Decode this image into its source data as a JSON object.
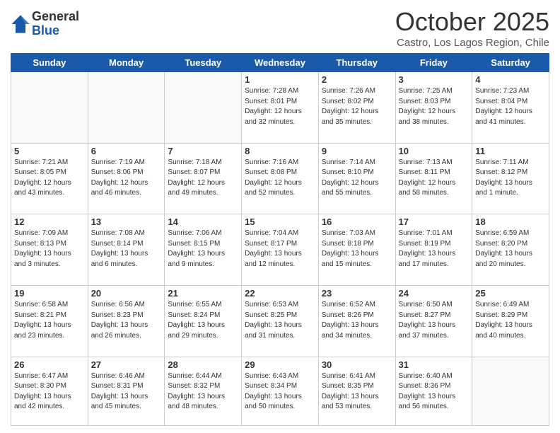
{
  "logo": {
    "general": "General",
    "blue": "Blue"
  },
  "header": {
    "month": "October 2025",
    "subtitle": "Castro, Los Lagos Region, Chile"
  },
  "weekdays": [
    "Sunday",
    "Monday",
    "Tuesday",
    "Wednesday",
    "Thursday",
    "Friday",
    "Saturday"
  ],
  "weeks": [
    [
      {
        "day": "",
        "info": ""
      },
      {
        "day": "",
        "info": ""
      },
      {
        "day": "",
        "info": ""
      },
      {
        "day": "1",
        "info": "Sunrise: 7:28 AM\nSunset: 8:01 PM\nDaylight: 12 hours\nand 32 minutes."
      },
      {
        "day": "2",
        "info": "Sunrise: 7:26 AM\nSunset: 8:02 PM\nDaylight: 12 hours\nand 35 minutes."
      },
      {
        "day": "3",
        "info": "Sunrise: 7:25 AM\nSunset: 8:03 PM\nDaylight: 12 hours\nand 38 minutes."
      },
      {
        "day": "4",
        "info": "Sunrise: 7:23 AM\nSunset: 8:04 PM\nDaylight: 12 hours\nand 41 minutes."
      }
    ],
    [
      {
        "day": "5",
        "info": "Sunrise: 7:21 AM\nSunset: 8:05 PM\nDaylight: 12 hours\nand 43 minutes."
      },
      {
        "day": "6",
        "info": "Sunrise: 7:19 AM\nSunset: 8:06 PM\nDaylight: 12 hours\nand 46 minutes."
      },
      {
        "day": "7",
        "info": "Sunrise: 7:18 AM\nSunset: 8:07 PM\nDaylight: 12 hours\nand 49 minutes."
      },
      {
        "day": "8",
        "info": "Sunrise: 7:16 AM\nSunset: 8:08 PM\nDaylight: 12 hours\nand 52 minutes."
      },
      {
        "day": "9",
        "info": "Sunrise: 7:14 AM\nSunset: 8:10 PM\nDaylight: 12 hours\nand 55 minutes."
      },
      {
        "day": "10",
        "info": "Sunrise: 7:13 AM\nSunset: 8:11 PM\nDaylight: 12 hours\nand 58 minutes."
      },
      {
        "day": "11",
        "info": "Sunrise: 7:11 AM\nSunset: 8:12 PM\nDaylight: 13 hours\nand 1 minute."
      }
    ],
    [
      {
        "day": "12",
        "info": "Sunrise: 7:09 AM\nSunset: 8:13 PM\nDaylight: 13 hours\nand 3 minutes."
      },
      {
        "day": "13",
        "info": "Sunrise: 7:08 AM\nSunset: 8:14 PM\nDaylight: 13 hours\nand 6 minutes."
      },
      {
        "day": "14",
        "info": "Sunrise: 7:06 AM\nSunset: 8:15 PM\nDaylight: 13 hours\nand 9 minutes."
      },
      {
        "day": "15",
        "info": "Sunrise: 7:04 AM\nSunset: 8:17 PM\nDaylight: 13 hours\nand 12 minutes."
      },
      {
        "day": "16",
        "info": "Sunrise: 7:03 AM\nSunset: 8:18 PM\nDaylight: 13 hours\nand 15 minutes."
      },
      {
        "day": "17",
        "info": "Sunrise: 7:01 AM\nSunset: 8:19 PM\nDaylight: 13 hours\nand 17 minutes."
      },
      {
        "day": "18",
        "info": "Sunrise: 6:59 AM\nSunset: 8:20 PM\nDaylight: 13 hours\nand 20 minutes."
      }
    ],
    [
      {
        "day": "19",
        "info": "Sunrise: 6:58 AM\nSunset: 8:21 PM\nDaylight: 13 hours\nand 23 minutes."
      },
      {
        "day": "20",
        "info": "Sunrise: 6:56 AM\nSunset: 8:23 PM\nDaylight: 13 hours\nand 26 minutes."
      },
      {
        "day": "21",
        "info": "Sunrise: 6:55 AM\nSunset: 8:24 PM\nDaylight: 13 hours\nand 29 minutes."
      },
      {
        "day": "22",
        "info": "Sunrise: 6:53 AM\nSunset: 8:25 PM\nDaylight: 13 hours\nand 31 minutes."
      },
      {
        "day": "23",
        "info": "Sunrise: 6:52 AM\nSunset: 8:26 PM\nDaylight: 13 hours\nand 34 minutes."
      },
      {
        "day": "24",
        "info": "Sunrise: 6:50 AM\nSunset: 8:27 PM\nDaylight: 13 hours\nand 37 minutes."
      },
      {
        "day": "25",
        "info": "Sunrise: 6:49 AM\nSunset: 8:29 PM\nDaylight: 13 hours\nand 40 minutes."
      }
    ],
    [
      {
        "day": "26",
        "info": "Sunrise: 6:47 AM\nSunset: 8:30 PM\nDaylight: 13 hours\nand 42 minutes."
      },
      {
        "day": "27",
        "info": "Sunrise: 6:46 AM\nSunset: 8:31 PM\nDaylight: 13 hours\nand 45 minutes."
      },
      {
        "day": "28",
        "info": "Sunrise: 6:44 AM\nSunset: 8:32 PM\nDaylight: 13 hours\nand 48 minutes."
      },
      {
        "day": "29",
        "info": "Sunrise: 6:43 AM\nSunset: 8:34 PM\nDaylight: 13 hours\nand 50 minutes."
      },
      {
        "day": "30",
        "info": "Sunrise: 6:41 AM\nSunset: 8:35 PM\nDaylight: 13 hours\nand 53 minutes."
      },
      {
        "day": "31",
        "info": "Sunrise: 6:40 AM\nSunset: 8:36 PM\nDaylight: 13 hours\nand 56 minutes."
      },
      {
        "day": "",
        "info": ""
      }
    ]
  ]
}
